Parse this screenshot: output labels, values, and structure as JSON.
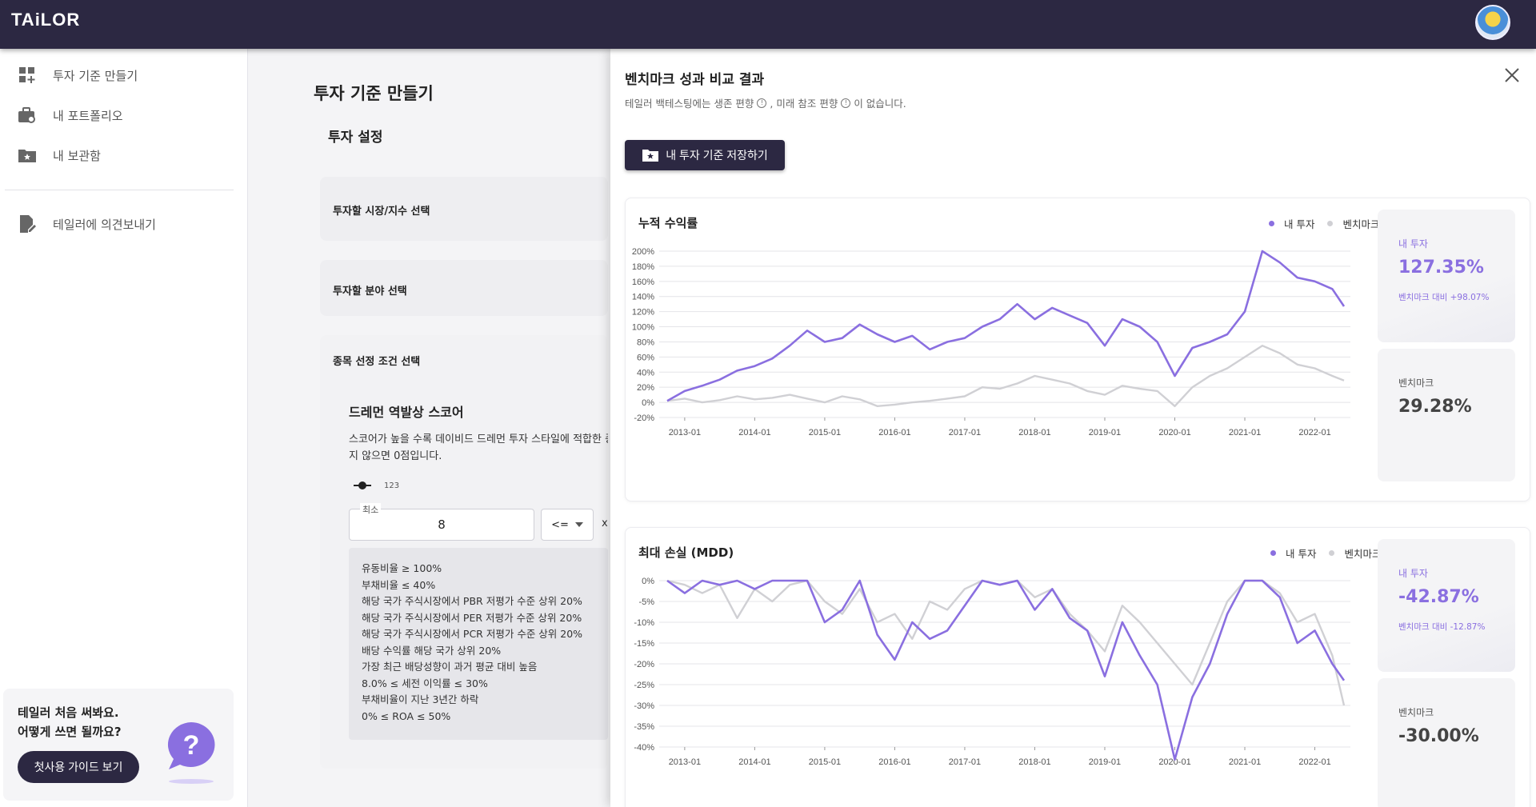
{
  "app": {
    "logo": "TAiLOR"
  },
  "sidebar": {
    "items": [
      {
        "label": "투자 기준 만들기"
      },
      {
        "label": "내 포트폴리오"
      },
      {
        "label": "내 보관함"
      },
      {
        "label": "테일러에 의견보내기"
      }
    ],
    "guide": {
      "line1": "테일러 처음 써봐요.",
      "line2": "어떻게 쓰면 될까요?",
      "button": "첫사용 가이드 보기"
    }
  },
  "main": {
    "title": "투자 기준 만들기",
    "section": "투자 설정",
    "cards": [
      "투자할 시장/지수 선택",
      "투자할 분야 선택",
      "종목 선정 조건 선택"
    ],
    "condition": {
      "title": "드레먼 역발상 스코어",
      "desc_line1": "스코어가 높을 수록 데이비드 드레먼 투자 스타일에 적합한 종",
      "desc_line2": "지 않으면 0점입니다.",
      "slider_value": "123",
      "min_label": "최소",
      "min_value": "8",
      "operator": "<=",
      "x_mark": "x",
      "rules": [
        "유동비율  ≥ 100%",
        "부채비율  ≤ 40%",
        "해당 국가 주식시장에서 PBR 저평가 수준 상위 20%",
        "해당 국가 주식시장에서 PER 저평가 수준 상위 20%",
        "해당 국가 주식시장에서 PCR 저평가 수준 상위 20%",
        "배당 수익률 해당 국가 상위 20%",
        "가장 최근 배당성향이 과거 평균 대비 높음",
        "8.0% ≤ 세전 이익률 ≤ 30%",
        "부채비율이 지난 3년간 하락",
        "0% ≤ ROA ≤ 50%"
      ]
    }
  },
  "panel": {
    "title": "벤치마크 성과 비교 결과",
    "note_part1": "테일러 백테스팅에는 생존 편향",
    "note_part2": ", 미래 참조 편향",
    "note_part3": "이 없습니다.",
    "info_glyph": "!",
    "save_button": "내 투자 기준 저장하기",
    "colors": {
      "mine": "#8a6fe0",
      "bench": "#d0d0d4"
    },
    "legend_mine": "내 투자",
    "legend_bench": "벤치마크",
    "cumulative": {
      "title": "누적 수익률",
      "mine_label": "내 투자",
      "mine_value": "127.35%",
      "mine_sub": "벤치마크 대비 +98.07%",
      "bench_label": "벤치마크",
      "bench_value": "29.28%"
    },
    "mdd": {
      "title": "최대 손실 (MDD)",
      "mine_label": "내 투자",
      "mine_value": "-42.87%",
      "mine_sub": "벤치마크 대비 -12.87%",
      "bench_label": "벤치마크",
      "bench_value": "-30.00%"
    }
  },
  "chart_data": [
    {
      "type": "line",
      "title": "누적 수익률",
      "x": [
        "2012-10",
        "2013-01",
        "2013-04",
        "2013-07",
        "2013-10",
        "2014-01",
        "2014-04",
        "2014-07",
        "2014-10",
        "2015-01",
        "2015-04",
        "2015-07",
        "2015-10",
        "2016-01",
        "2016-04",
        "2016-07",
        "2016-10",
        "2017-01",
        "2017-04",
        "2017-07",
        "2017-10",
        "2018-01",
        "2018-04",
        "2018-07",
        "2018-10",
        "2019-01",
        "2019-04",
        "2019-07",
        "2019-10",
        "2020-01",
        "2020-04",
        "2020-07",
        "2020-10",
        "2021-01",
        "2021-04",
        "2021-07",
        "2021-10",
        "2022-01",
        "2022-04",
        "2022-06"
      ],
      "x_ticks": [
        "2013-01",
        "2014-01",
        "2015-01",
        "2016-01",
        "2017-01",
        "2018-01",
        "2019-01",
        "2020-01",
        "2021-01",
        "2022-01"
      ],
      "y_ticks": [
        "-20%",
        "0%",
        "20%",
        "40%",
        "60%",
        "80%",
        "100%",
        "120%",
        "140%",
        "160%",
        "180%",
        "200%"
      ],
      "ylim": [
        -20,
        200
      ],
      "series": [
        {
          "name": "내 투자",
          "values": [
            2,
            15,
            22,
            30,
            42,
            48,
            58,
            75,
            95,
            80,
            85,
            103,
            90,
            80,
            88,
            70,
            80,
            85,
            100,
            110,
            130,
            110,
            125,
            115,
            105,
            75,
            110,
            100,
            80,
            35,
            72,
            80,
            90,
            120,
            200,
            185,
            165,
            160,
            150,
            127
          ]
        },
        {
          "name": "벤치마크",
          "values": [
            2,
            5,
            0,
            3,
            8,
            4,
            6,
            10,
            5,
            0,
            8,
            4,
            -5,
            -3,
            0,
            2,
            5,
            8,
            20,
            18,
            25,
            35,
            30,
            25,
            15,
            10,
            22,
            18,
            15,
            -5,
            20,
            35,
            45,
            60,
            75,
            65,
            50,
            45,
            35,
            29
          ]
        }
      ]
    },
    {
      "type": "line",
      "title": "최대 손실 (MDD)",
      "x": [
        "2012-10",
        "2013-01",
        "2013-04",
        "2013-07",
        "2013-10",
        "2014-01",
        "2014-04",
        "2014-07",
        "2014-10",
        "2015-01",
        "2015-04",
        "2015-07",
        "2015-10",
        "2016-01",
        "2016-04",
        "2016-07",
        "2016-10",
        "2017-01",
        "2017-04",
        "2017-07",
        "2017-10",
        "2018-01",
        "2018-04",
        "2018-07",
        "2018-10",
        "2019-01",
        "2019-04",
        "2019-07",
        "2019-10",
        "2020-01",
        "2020-04",
        "2020-07",
        "2020-10",
        "2021-01",
        "2021-04",
        "2021-07",
        "2021-10",
        "2022-01",
        "2022-04",
        "2022-06"
      ],
      "x_ticks": [
        "2013-01",
        "2014-01",
        "2015-01",
        "2016-01",
        "2017-01",
        "2018-01",
        "2019-01",
        "2020-01",
        "2021-01",
        "2022-01"
      ],
      "y_ticks": [
        "0%",
        "-5%",
        "-10%",
        "-15%",
        "-20%",
        "-25%",
        "-30%",
        "-35%",
        "-40%"
      ],
      "ylim": [
        -40,
        0
      ],
      "series": [
        {
          "name": "내 투자",
          "values": [
            0,
            -3,
            0,
            -1,
            0,
            -2,
            0,
            0,
            0,
            -10,
            -7,
            0,
            -13,
            -19,
            -10,
            -14,
            -12,
            -6,
            0,
            -1,
            0,
            -7,
            -2,
            -9,
            -12,
            -23,
            -10,
            -18,
            -25,
            -43,
            -28,
            -20,
            -8,
            0,
            0,
            -4,
            -15,
            -12,
            -20,
            -24
          ]
        },
        {
          "name": "벤치마크",
          "values": [
            0,
            -1,
            -3,
            -1,
            -9,
            -2,
            -5,
            -1,
            0,
            -5,
            -8,
            -2,
            -10,
            -8,
            -14,
            -5,
            -7,
            -2,
            0,
            -1,
            0,
            -4,
            -2,
            -8,
            -12,
            -17,
            -6,
            -10,
            -15,
            -20,
            -25,
            -15,
            -5,
            0,
            0,
            -3,
            -10,
            -8,
            -18,
            -30
          ]
        }
      ]
    }
  ]
}
